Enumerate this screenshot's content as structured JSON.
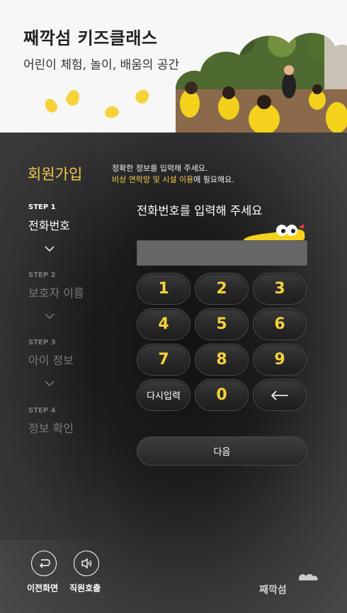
{
  "header": {
    "title": "째깍섬 키즈클래스",
    "subtitle": "어린이 체험, 놀이, 배움의 공간"
  },
  "signup": {
    "title": "회원가입",
    "notice_line1": "정확한 정보를 입력해 주세요.",
    "notice_highlight": "비상 연락망 및 시설 이용",
    "notice_rest": "에 필요해요."
  },
  "steps": [
    {
      "num": "STEP 1",
      "label": "전화번호",
      "active": true
    },
    {
      "num": "STEP 2",
      "label": "보호자 이름",
      "active": false
    },
    {
      "num": "STEP 3",
      "label": "아이 정보",
      "active": false
    },
    {
      "num": "STEP 4",
      "label": "정보 확인",
      "active": false
    }
  ],
  "form": {
    "prompt": "전화번호를 입력해 주세요",
    "phone_value": ""
  },
  "keypad": {
    "k1": "1",
    "k2": "2",
    "k3": "3",
    "k4": "4",
    "k5": "5",
    "k6": "6",
    "k7": "7",
    "k8": "8",
    "k9": "9",
    "reset": "다시입력",
    "k0": "0",
    "backspace": "←"
  },
  "next_label": "다음",
  "footer": {
    "back_label": "이전화면",
    "call_label": "직원호출",
    "logo_text": "째깍섬"
  },
  "colors": {
    "accent": "#f2c94c",
    "panel": "#2a2a2a"
  }
}
